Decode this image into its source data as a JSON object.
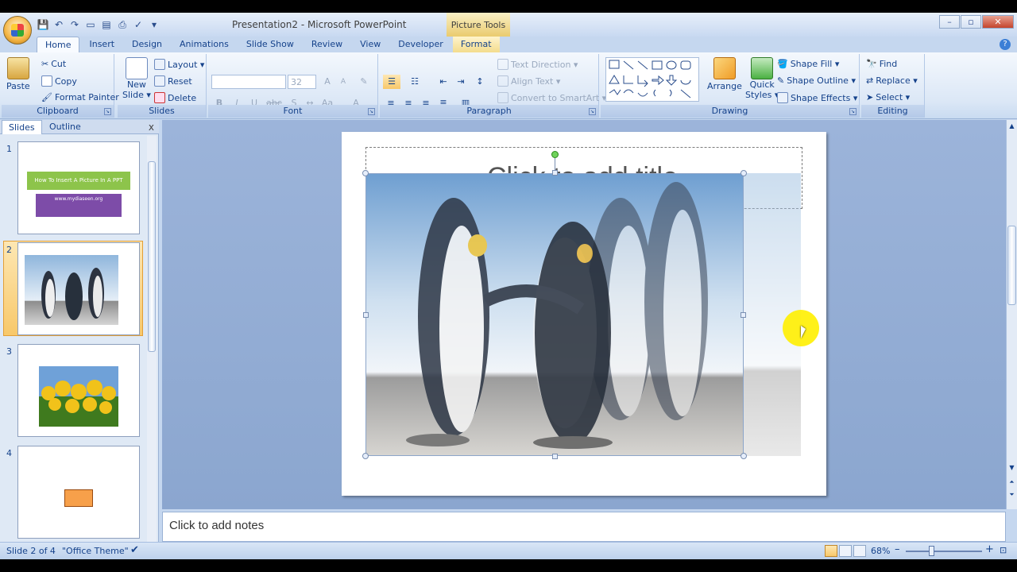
{
  "window": {
    "title": "Presentation2 - Microsoft PowerPoint",
    "context_tab_group": "Picture Tools",
    "controls": {
      "minimize": "–",
      "maximize": "▫",
      "close": "✕"
    }
  },
  "tabs": [
    {
      "label": "Home",
      "active": true
    },
    {
      "label": "Insert"
    },
    {
      "label": "Design"
    },
    {
      "label": "Animations"
    },
    {
      "label": "Slide Show"
    },
    {
      "label": "Review"
    },
    {
      "label": "View"
    },
    {
      "label": "Developer"
    },
    {
      "label": "Format",
      "contextual": true
    }
  ],
  "ribbon": {
    "clipboard": {
      "label": "Clipboard",
      "paste": "Paste",
      "cut": "Cut",
      "copy": "Copy",
      "format_painter": "Format Painter"
    },
    "slides": {
      "label": "Slides",
      "new_slide_l1": "New",
      "new_slide_l2": "Slide ▾",
      "layout": "Layout ▾",
      "reset": "Reset",
      "delete": "Delete"
    },
    "font": {
      "label": "Font",
      "size": "32",
      "bold": "B",
      "italic": "I",
      "underline": "U",
      "strike": "abc",
      "shadow": "S",
      "grow": "A",
      "shrink": "A",
      "color": "A"
    },
    "paragraph": {
      "label": "Paragraph",
      "text_direction": "Text Direction ▾",
      "align_text": "Align Text ▾",
      "convert_smartart": "Convert to SmartArt ▾"
    },
    "drawing": {
      "label": "Drawing",
      "arrange": "Arrange",
      "quick_styles_l1": "Quick",
      "quick_styles_l2": "Styles ▾",
      "shape_fill": "Shape Fill ▾",
      "shape_outline": "Shape Outline ▾",
      "shape_effects": "Shape Effects ▾"
    },
    "editing": {
      "label": "Editing",
      "find": "Find",
      "replace": "Replace ▾",
      "select": "Select ▾"
    }
  },
  "left_pane": {
    "tabs": [
      "Slides",
      "Outline"
    ],
    "close": "x",
    "slides": [
      {
        "num": "1",
        "heading": "How To Insert A Picture In A PPT",
        "sub": "www.mydiaseen.org"
      },
      {
        "num": "2",
        "selected": true
      },
      {
        "num": "3"
      },
      {
        "num": "4"
      }
    ]
  },
  "slide": {
    "title_placeholder": "Click to add title"
  },
  "notes": {
    "placeholder": "Click to add notes"
  },
  "status": {
    "slide_of": "Slide 2 of 4",
    "theme": "\"Office Theme\"",
    "zoom": "68%",
    "zoom_minus": "–",
    "zoom_plus": "+"
  },
  "colors": {
    "accent_selection": "#f8c86a",
    "ribbon_text": "#15428b",
    "slide1_green": "#8dc44b",
    "slide1_purple": "#7d4ca8"
  }
}
